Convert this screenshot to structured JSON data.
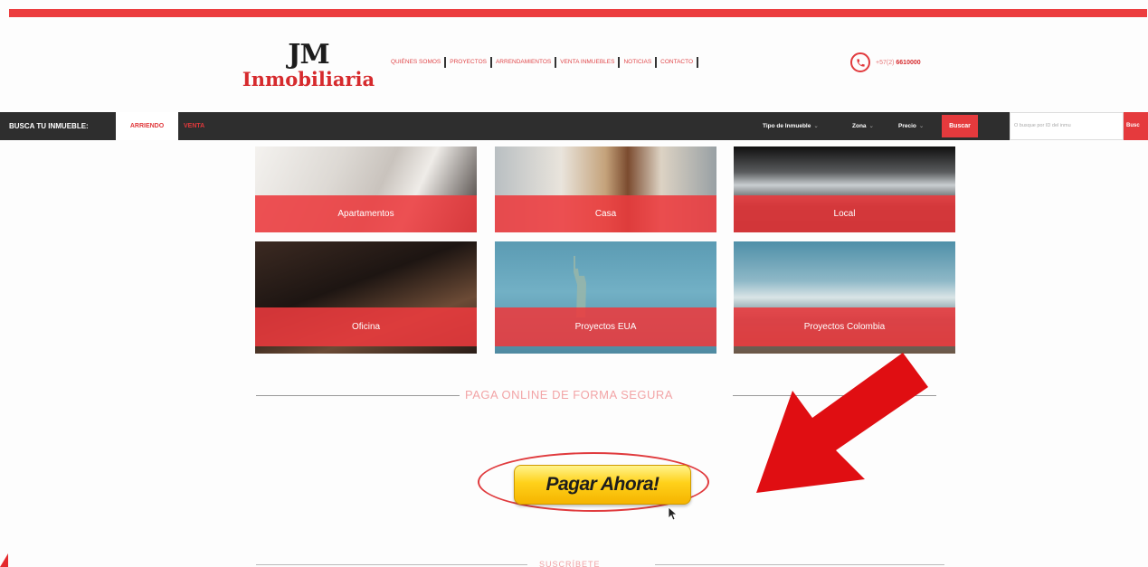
{
  "brand": {
    "logo_top": "JM",
    "logo_bottom": "Inmobiliaria",
    "accent_color": "#ec3d3f"
  },
  "nav": {
    "items": [
      {
        "label": "QUIÉNES SOMOS"
      },
      {
        "label": "PROYECTOS"
      },
      {
        "label": "ARRENDAMIENTOS"
      },
      {
        "label": "VENTA INMUEBLES"
      },
      {
        "label": "NOTICIAS"
      },
      {
        "label": "CONTACTO"
      }
    ]
  },
  "phone": {
    "icon": "phone-icon",
    "prefix": "+57(2)",
    "number": "6610000"
  },
  "search": {
    "label": "BUSCA TU INMUEBLE:",
    "tab_rent": "ARRIENDO",
    "tab_sale": "VENTA",
    "filter_type": "Tipo de Inmueble",
    "filter_zone": "Zona",
    "filter_price": "Precio",
    "button": "Buscar",
    "input_placeholder": "O busque por ID del inmu",
    "go_button": "Busc"
  },
  "categories": [
    {
      "label": "Apartamentos"
    },
    {
      "label": "Casa"
    },
    {
      "label": "Local"
    },
    {
      "label": "Oficina"
    },
    {
      "label": "Proyectos EUA"
    },
    {
      "label": "Proyectos Colombia"
    }
  ],
  "payment": {
    "title": "PAGA ONLINE DE FORMA SEGURA",
    "button": "Pagar Ahora!"
  },
  "footer_heading": "SUSCRÍBETE"
}
